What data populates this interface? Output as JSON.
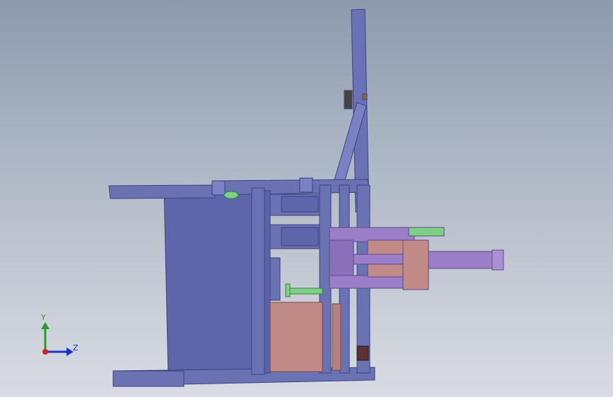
{
  "viewport": {
    "background_top": "#8d9aae",
    "background_bottom": "#d9dce2"
  },
  "model": {
    "colors": {
      "frame": "#6a72b4",
      "frame_dark": "#4e5596",
      "panel": "#5d66ab",
      "arm": "#9a7fc8",
      "block": "#c28a86",
      "green_part": "#7fcf86",
      "dark_part": "#5a3236"
    }
  },
  "triad": {
    "y_label": "Y",
    "z_label": "Z",
    "y_color": "#2c9a2c",
    "z_color": "#1d33c8",
    "x_color": "#d42020"
  }
}
